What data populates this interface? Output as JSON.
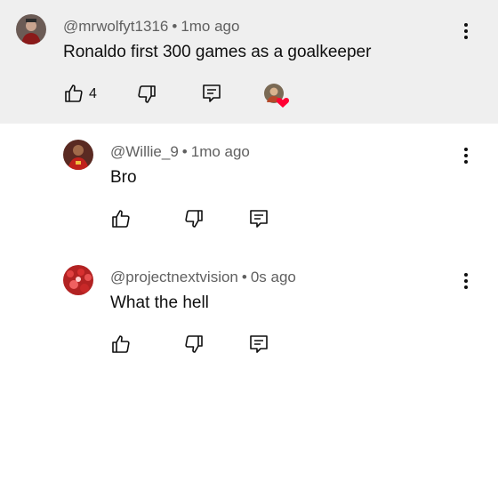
{
  "comments": [
    {
      "author": "@mrwolfyt1316",
      "separator": "•",
      "time": "1mo ago",
      "text": "Ronaldo first 300 games as a goalkeeper",
      "likes": "4",
      "creator_hearted": true,
      "avatar_icon": "user-avatar-dark",
      "highlighted": true
    },
    {
      "author": "@Willie_9",
      "separator": "•",
      "time": "1mo ago",
      "text": "Bro",
      "avatar_icon": "user-avatar-red-jersey"
    },
    {
      "author": "@projectnextvision",
      "separator": "•",
      "time": "0s ago",
      "text": "What the hell",
      "avatar_icon": "user-avatar-red-crowd"
    }
  ],
  "icons": {
    "like": "thumbs-up-icon",
    "dislike": "thumbs-down-icon",
    "reply": "reply-icon",
    "more": "more-vertical-icon",
    "heart": "heart-icon"
  },
  "colors": {
    "highlight_bg": "#efefef",
    "heart": "#ff0033",
    "meta_text": "#606060"
  }
}
